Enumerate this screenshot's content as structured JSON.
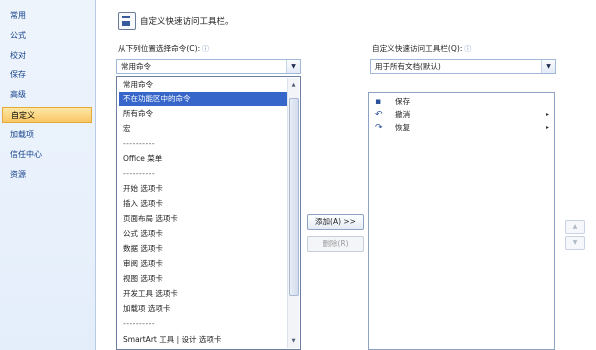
{
  "nav": {
    "items": [
      {
        "label": "常用"
      },
      {
        "label": "公式"
      },
      {
        "label": "校对"
      },
      {
        "label": "保存"
      },
      {
        "label": "高级"
      },
      {
        "label": "自定义"
      },
      {
        "label": "加载项"
      },
      {
        "label": "信任中心"
      },
      {
        "label": "资源"
      }
    ],
    "active_index": 5
  },
  "header": {
    "title": "自定义快速访问工具栏。"
  },
  "left_panel": {
    "label": "从下列位置选择命令(C):",
    "info_icon": "ⓘ",
    "combo_value": "常用命令",
    "list": [
      "常用命令",
      "不在功能区中的命令",
      "所有命令",
      "宏",
      "----------",
      "Office 菜单",
      "----------",
      "开始 选项卡",
      "插入 选项卡",
      "页面布局 选项卡",
      "公式 选项卡",
      "数据 选项卡",
      "审阅 选项卡",
      "视图 选项卡",
      "开发工具 选项卡",
      "加载项 选项卡",
      "----------",
      "SmartArt 工具 | 设计 选项卡"
    ],
    "selected_index": 1
  },
  "middle": {
    "add_label": "添加(A) >>",
    "remove_label": "删除(R)"
  },
  "right_panel": {
    "label": "自定义快速访问工具栏(Q):",
    "info_icon": "ⓘ",
    "combo_value": "用于所有文档(默认)",
    "items": [
      {
        "label": "保存",
        "icon": "save-icon",
        "glyph": "▪",
        "has_submenu": false
      },
      {
        "label": "撤消",
        "icon": "undo-icon",
        "glyph": "↶",
        "has_submenu": true
      },
      {
        "label": "恢复",
        "icon": "redo-icon",
        "glyph": "↷",
        "has_submenu": true
      }
    ],
    "submenu_glyph": "▸"
  },
  "move_buttons": {
    "up": "▲",
    "down": "▼"
  },
  "dropdown_arrow": "▼",
  "scroll": {
    "up": "▲",
    "down": "▼"
  }
}
